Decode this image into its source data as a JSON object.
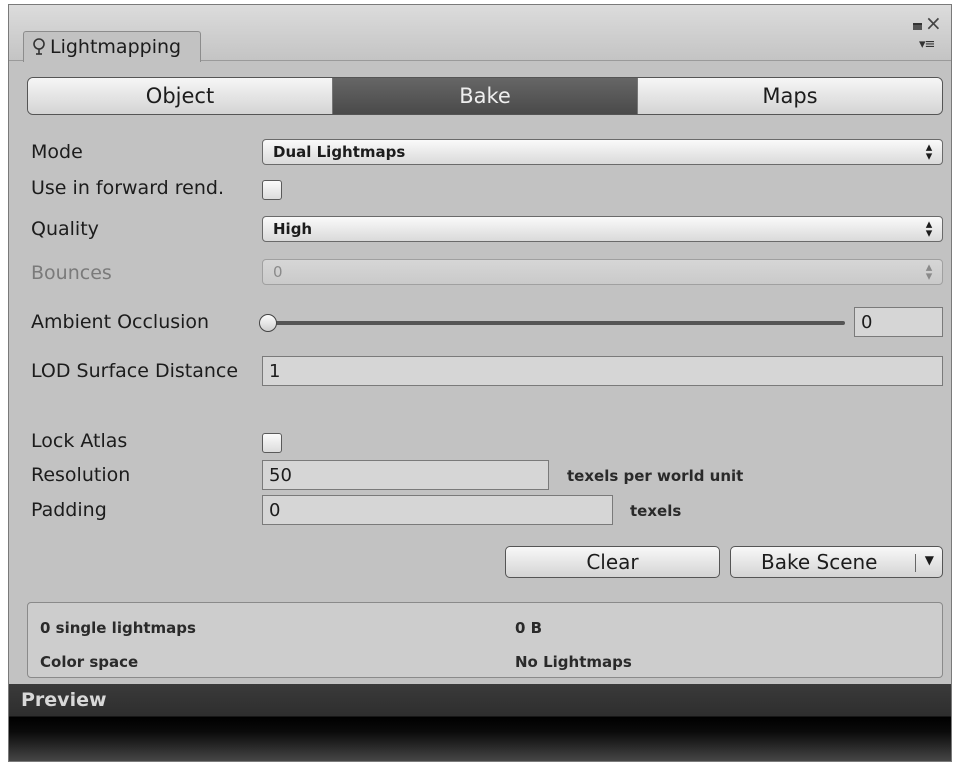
{
  "window": {
    "tab_title": "Lightmapping",
    "tab_icon": "lightbulb-icon"
  },
  "tabs": [
    {
      "label": "Object",
      "active": false
    },
    {
      "label": "Bake",
      "active": true
    },
    {
      "label": "Maps",
      "active": false
    }
  ],
  "settings": {
    "mode_label": "Mode",
    "mode_value": "Dual Lightmaps",
    "forward_label": "Use in forward rend.",
    "forward_checked": false,
    "quality_label": "Quality",
    "quality_value": "High",
    "bounces_label": "Bounces",
    "bounces_value": "0",
    "ao_label": "Ambient Occlusion",
    "ao_value": "0",
    "lod_label": "LOD Surface Distance",
    "lod_value": "1",
    "lock_atlas_label": "Lock Atlas",
    "lock_atlas_checked": false,
    "resolution_label": "Resolution",
    "resolution_value": "50",
    "resolution_unit": "texels per world unit",
    "padding_label": "Padding",
    "padding_value": "0",
    "padding_unit": "texels"
  },
  "actions": {
    "clear_label": "Clear",
    "bake_label": "Bake Scene"
  },
  "info": {
    "lightmaps_count": "0 single lightmaps",
    "size": "0 B",
    "color_space_label": "Color space",
    "color_space_value": "No Lightmaps"
  },
  "preview": {
    "title": "Preview"
  }
}
